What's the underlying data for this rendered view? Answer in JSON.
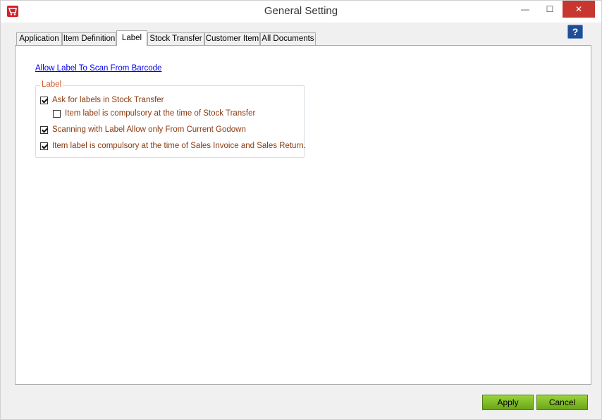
{
  "window": {
    "title": "General Setting"
  },
  "titlebar": {
    "minimize": "—",
    "maximize": "☐",
    "close": "✕"
  },
  "help": {
    "label": "?"
  },
  "tabs": [
    {
      "label": "Application"
    },
    {
      "label": "Item Definition"
    },
    {
      "label": "Label"
    },
    {
      "label": "Stock Transfer"
    },
    {
      "label": "Customer Item"
    },
    {
      "label": "All Documents"
    }
  ],
  "active_tab": "Label",
  "content": {
    "link": "Allow Label To Scan From Barcode",
    "group_title": "Label",
    "options": [
      {
        "label": "Ask for labels in Stock Transfer",
        "checked": true
      },
      {
        "label": "Item label is compulsory at the time of Stock Transfer",
        "checked": false
      },
      {
        "label": "Scanning with Label Allow only From Current Godown",
        "checked": true
      },
      {
        "label": "Item label is compulsory at the time of Sales Invoice and Sales Return.",
        "checked": true
      }
    ]
  },
  "footer": {
    "apply": "Apply",
    "cancel": "Cancel"
  },
  "colors": {
    "accent": "#7ab829",
    "label_text": "#8b3a10",
    "link": "#0000ee"
  }
}
